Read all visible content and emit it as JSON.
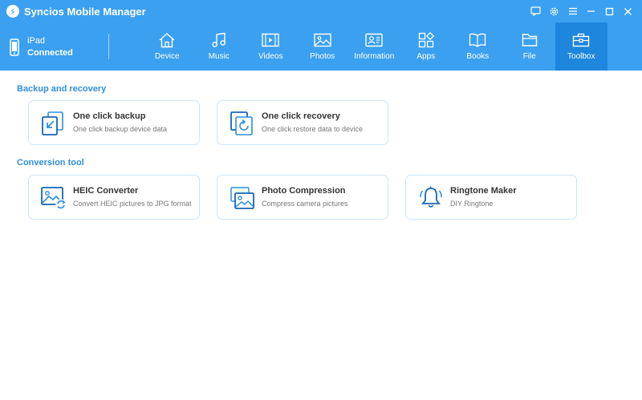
{
  "app": {
    "title": "Syncios Mobile Manager"
  },
  "window_controls": [
    "chat-icon",
    "settings-icon",
    "menu-icon",
    "minimize-icon",
    "maximize-icon",
    "close-icon"
  ],
  "device": {
    "name": "iPad",
    "status": "Connected"
  },
  "nav": {
    "active": "Toolbox",
    "items": [
      {
        "label": "Device",
        "icon": "home-icon"
      },
      {
        "label": "Music",
        "icon": "music-icon"
      },
      {
        "label": "Videos",
        "icon": "video-icon"
      },
      {
        "label": "Photos",
        "icon": "photo-icon"
      },
      {
        "label": "Information",
        "icon": "contact-card-icon"
      },
      {
        "label": "Apps",
        "icon": "apps-icon"
      },
      {
        "label": "Books",
        "icon": "book-icon"
      },
      {
        "label": "File",
        "icon": "folder-icon"
      },
      {
        "label": "Toolbox",
        "icon": "toolbox-icon"
      }
    ]
  },
  "sections": {
    "backup": {
      "title": "Backup and recovery",
      "cards": [
        {
          "title": "One click backup",
          "desc": "One click backup device data",
          "icon": "backup-icon"
        },
        {
          "title": "One click recovery",
          "desc": "One click restore data to device",
          "icon": "recovery-icon"
        }
      ]
    },
    "conversion": {
      "title": "Conversion tool",
      "cards": [
        {
          "title": "HEIC Converter",
          "desc": "Convert HEIC pictures to JPG format",
          "icon": "heic-converter-icon"
        },
        {
          "title": "Photo Compression",
          "desc": "Compress camera pictures",
          "icon": "photo-compression-icon"
        },
        {
          "title": "Ringtone Maker",
          "desc": "DIY Ringtone",
          "icon": "bell-icon"
        }
      ]
    }
  },
  "colors": {
    "header": "#3ba0f0",
    "active_tab": "#1e86dc",
    "accent": "#2f8fe0",
    "card_border": "#cfe6f8"
  }
}
